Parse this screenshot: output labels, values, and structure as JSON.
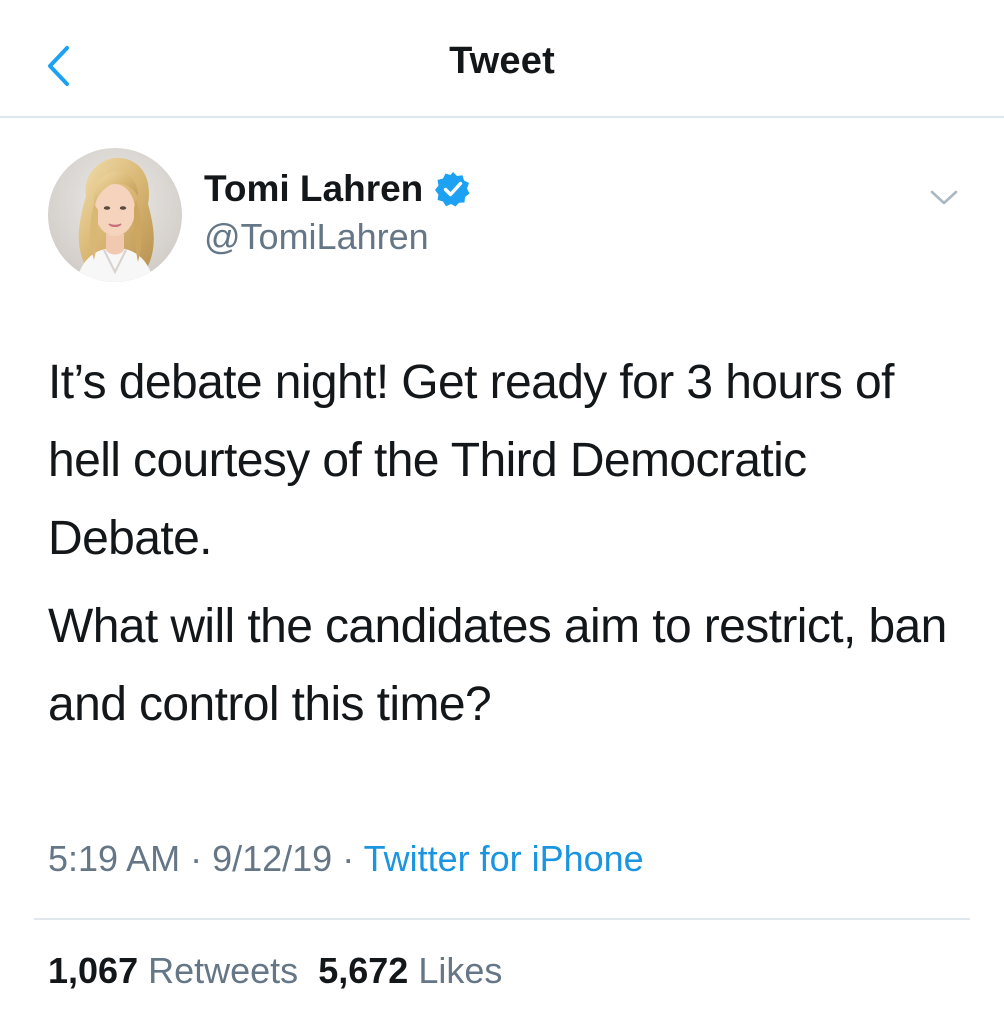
{
  "nav": {
    "title": "Tweet",
    "back_icon": "chevron-left-icon"
  },
  "tweet": {
    "author": {
      "display_name": "Tomi Lahren",
      "handle": "@TomiLahren",
      "verified_icon": "verified-badge-icon"
    },
    "menu_icon": "chevron-down-icon",
    "text": {
      "paragraph_1": "It’s debate night! Get ready for 3 hours of hell courtesy of the Third Democratic Debate.",
      "paragraph_2": "What will the candidates aim to restrict, ban and control this time?"
    },
    "meta": {
      "time": "5:19 AM",
      "separator_1": " · ",
      "date": "9/12/19",
      "separator_2": " · ",
      "source": "Twitter for iPhone"
    },
    "stats": {
      "retweets_count": "1,067",
      "retweets_label": "Retweets",
      "likes_count": "5,672",
      "likes_label": "Likes"
    }
  },
  "colors": {
    "accent": "#1b95e0",
    "text_primary": "#14171a",
    "text_secondary": "#657786",
    "divider": "#e1e8ed",
    "verified": "#1da1f2"
  }
}
